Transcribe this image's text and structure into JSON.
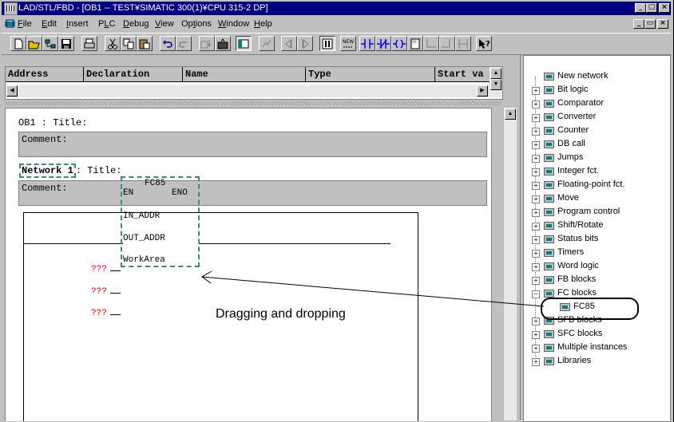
{
  "window": {
    "title": "LAD/STL/FBD  - [OB1 -- TEST¥SIMATIC 300(1)¥CPU 315-2 DP]",
    "controls": [
      "_",
      "□",
      "×"
    ],
    "mdi_controls": [
      "_",
      "▭",
      "×"
    ]
  },
  "menu": [
    {
      "label": "File",
      "ul": "F"
    },
    {
      "label": "Edit",
      "ul": "E"
    },
    {
      "label": "Insert",
      "ul": "I"
    },
    {
      "label": "PLC",
      "ul": "L"
    },
    {
      "label": "Debug",
      "ul": "D"
    },
    {
      "label": "View",
      "ul": "V"
    },
    {
      "label": "Options",
      "ul": "t"
    },
    {
      "label": "Window",
      "ul": "W"
    },
    {
      "label": "Help",
      "ul": "H"
    }
  ],
  "declaration": {
    "columns": [
      "Address",
      "Declaration",
      "Name",
      "Type",
      "Start va"
    ]
  },
  "block": {
    "title_line": "OB1 : Title:",
    "comment_label": "Comment:",
    "network_label": "Network 1",
    "network_title": ": Title:",
    "network_comment": "Comment:"
  },
  "fc_box": {
    "name": "FC85",
    "en": "EN",
    "eno": "ENO",
    "inputs": [
      "IN_ADDR",
      "OUT_ADDR",
      "WorkArea"
    ],
    "placeholder": "???"
  },
  "catalog": {
    "items": [
      {
        "label": "New network",
        "expander": ""
      },
      {
        "label": "Bit logic",
        "expander": "+"
      },
      {
        "label": "Comparator",
        "expander": "+"
      },
      {
        "label": "Converter",
        "expander": "+"
      },
      {
        "label": "Counter",
        "expander": "+"
      },
      {
        "label": "DB call",
        "expander": "+"
      },
      {
        "label": "Jumps",
        "expander": "+"
      },
      {
        "label": "Integer fct.",
        "expander": "+"
      },
      {
        "label": "Floating-point fct.",
        "expander": "+"
      },
      {
        "label": "Move",
        "expander": "+"
      },
      {
        "label": "Program control",
        "expander": "+"
      },
      {
        "label": "Shift/Rotate",
        "expander": "+"
      },
      {
        "label": "Status bits",
        "expander": "+"
      },
      {
        "label": "Timers",
        "expander": "+"
      },
      {
        "label": "Word logic",
        "expander": "+"
      },
      {
        "label": "FB blocks",
        "expander": "+"
      },
      {
        "label": "FC blocks",
        "expander": "−"
      },
      {
        "label": "FC85",
        "expander": "",
        "child": true
      },
      {
        "label": "SFB blocks",
        "expander": "+"
      },
      {
        "label": "SFC blocks",
        "expander": "+"
      },
      {
        "label": "Multiple instances",
        "expander": "+"
      },
      {
        "label": "Libraries",
        "expander": "+"
      }
    ]
  },
  "annotation": {
    "text": "Dragging and dropping"
  },
  "colors": {
    "titlebar": "#000080",
    "face": "#c0c0c0",
    "selection_dash": "#3a8a8a",
    "placeholder_red": "#ff0000"
  }
}
